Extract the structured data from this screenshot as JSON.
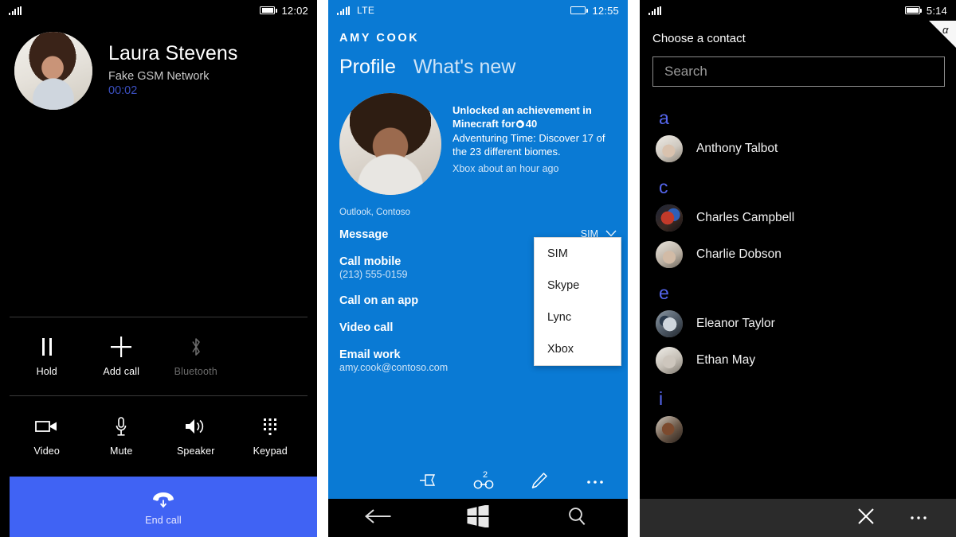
{
  "panel_call": {
    "status": {
      "time": "12:02",
      "signal_icon": "signal-bars-icon",
      "battery_icon": "battery-icon"
    },
    "contact_name": "Laura Stevens",
    "network": "Fake GSM Network",
    "timer": "00:02",
    "avatar_name": "laura-stevens-photo",
    "actions_row1": [
      {
        "label": "Hold",
        "icon": "pause-icon",
        "disabled": false
      },
      {
        "label": "Add call",
        "icon": "plus-icon",
        "disabled": false
      },
      {
        "label": "Bluetooth",
        "icon": "bluetooth-icon",
        "disabled": true
      }
    ],
    "actions_row2": [
      {
        "label": "Video",
        "icon": "video-camera-icon"
      },
      {
        "label": "Mute",
        "icon": "microphone-icon"
      },
      {
        "label": "Speaker",
        "icon": "speaker-icon"
      },
      {
        "label": "Keypad",
        "icon": "dialpad-icon"
      }
    ],
    "end_call": {
      "label": "End call",
      "icon": "end-call-icon",
      "color": "#4063f4"
    }
  },
  "panel_profile": {
    "status": {
      "time": "12:55",
      "network_type": "LTE",
      "signal_icon": "signal-bars-icon",
      "battery_icon": "battery-icon"
    },
    "app_title": "AMY COOK",
    "accent_color": "#0a7ad4",
    "tabs": [
      {
        "label": "Profile",
        "active": true
      },
      {
        "label": "What's new",
        "active": false
      }
    ],
    "avatar_name": "amy-cook-photo",
    "achievement": {
      "line1": "Unlocked an achievement in",
      "line2_prefix": "Minecraft for",
      "gamerscore": "40",
      "description": "Adventuring Time: Discover 17 of the 23 different biomes.",
      "source": "Xbox about an hour ago"
    },
    "account_source": "Outlook, Contoso",
    "items": [
      {
        "title": "Message",
        "subtitle": ""
      },
      {
        "title": "Call mobile",
        "subtitle": "(213) 555-0159"
      },
      {
        "title": "Call on an app",
        "subtitle": ""
      },
      {
        "title": "Video call",
        "subtitle": ""
      },
      {
        "title": "Email work",
        "subtitle": "amy.cook@contoso.com"
      }
    ],
    "sim_selector": {
      "value": "SIM",
      "chevron_icon": "chevron-down-icon"
    },
    "dropdown_options": [
      "SIM",
      "Skype",
      "Lync",
      "Xbox"
    ],
    "appbar": [
      {
        "icon": "pin-icon",
        "badge": ""
      },
      {
        "icon": "link-icon",
        "badge": "2"
      },
      {
        "icon": "edit-pencil-icon",
        "badge": ""
      },
      {
        "icon": "more-ellipsis-icon",
        "badge": ""
      }
    ],
    "navbar": [
      {
        "icon": "back-arrow-icon"
      },
      {
        "icon": "windows-start-icon"
      },
      {
        "icon": "search-icon"
      }
    ]
  },
  "panel_contacts": {
    "status": {
      "time": "5:14",
      "signal_icon": "signal-bars-icon",
      "battery_icon": "battery-icon"
    },
    "corner_tag": "α",
    "header": "Choose a contact",
    "search_placeholder": "Search",
    "letter_color": "#5566ee",
    "groups": [
      {
        "letter": "a",
        "contacts": [
          {
            "name": "Anthony Talbot",
            "avatar": "anthony-talbot-photo"
          }
        ]
      },
      {
        "letter": "c",
        "contacts": [
          {
            "name": "Charles Campbell",
            "avatar": "charles-campbell-photo"
          },
          {
            "name": "Charlie Dobson",
            "avatar": "charlie-dobson-photo"
          }
        ]
      },
      {
        "letter": "e",
        "contacts": [
          {
            "name": "Eleanor Taylor",
            "avatar": "eleanor-taylor-photo"
          },
          {
            "name": "Ethan May",
            "avatar": "ethan-may-photo"
          }
        ]
      },
      {
        "letter": "i",
        "contacts": [
          {
            "name": "",
            "avatar": "cut-off-contact-photo"
          }
        ]
      }
    ],
    "appbar": [
      {
        "icon": "close-x-icon"
      },
      {
        "icon": "more-ellipsis-icon"
      }
    ]
  }
}
